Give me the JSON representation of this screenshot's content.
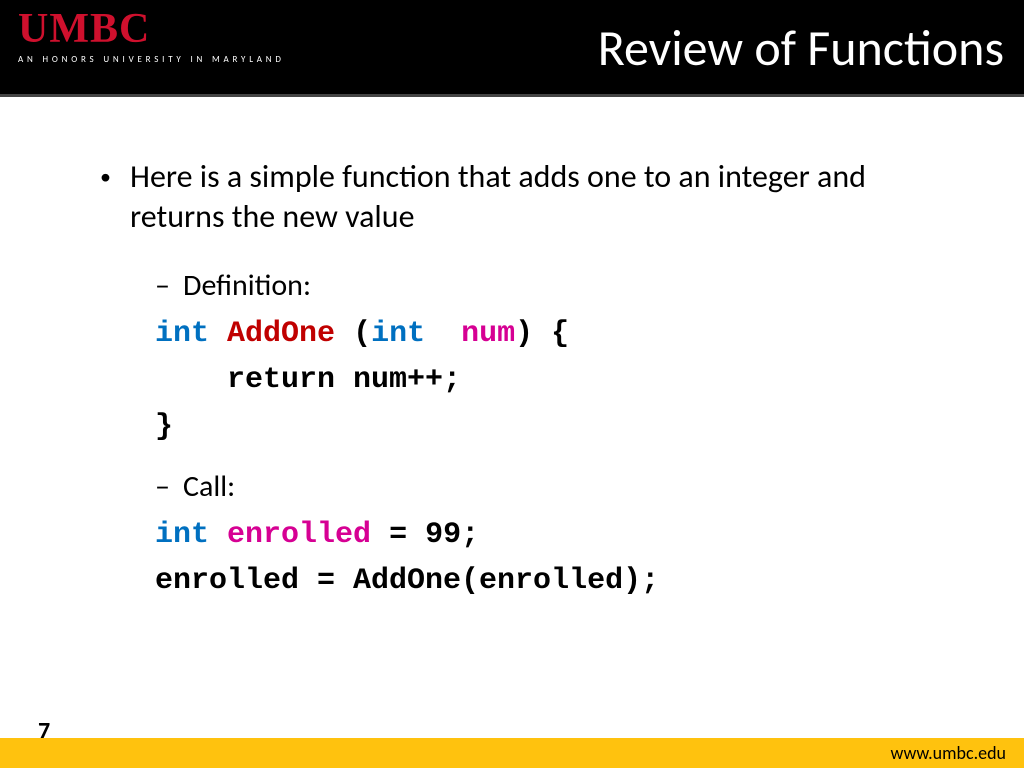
{
  "header": {
    "logo_main": "UMBC",
    "logo_sub": "AN HONORS UNIVERSITY IN MARYLAND",
    "title": "Review of Functions"
  },
  "body": {
    "bullet1": "Here is a simple function that adds one to an integer and returns the new value",
    "def_label": "Definition:",
    "call_label": "Call:"
  },
  "code": {
    "def_int1": "int",
    "def_name": "AddOne",
    "def_paren_open": " (",
    "def_int2": "int",
    "def_param": "num",
    "def_paren_close": ") {",
    "def_body": "    return num++;",
    "def_close": "}",
    "call_int": "int",
    "call_var": "enrolled",
    "call_assign": " = 99;",
    "call_line2": "enrolled = AddOne(enrolled);"
  },
  "footer": {
    "page": "7",
    "url": "www.umbc.edu"
  }
}
